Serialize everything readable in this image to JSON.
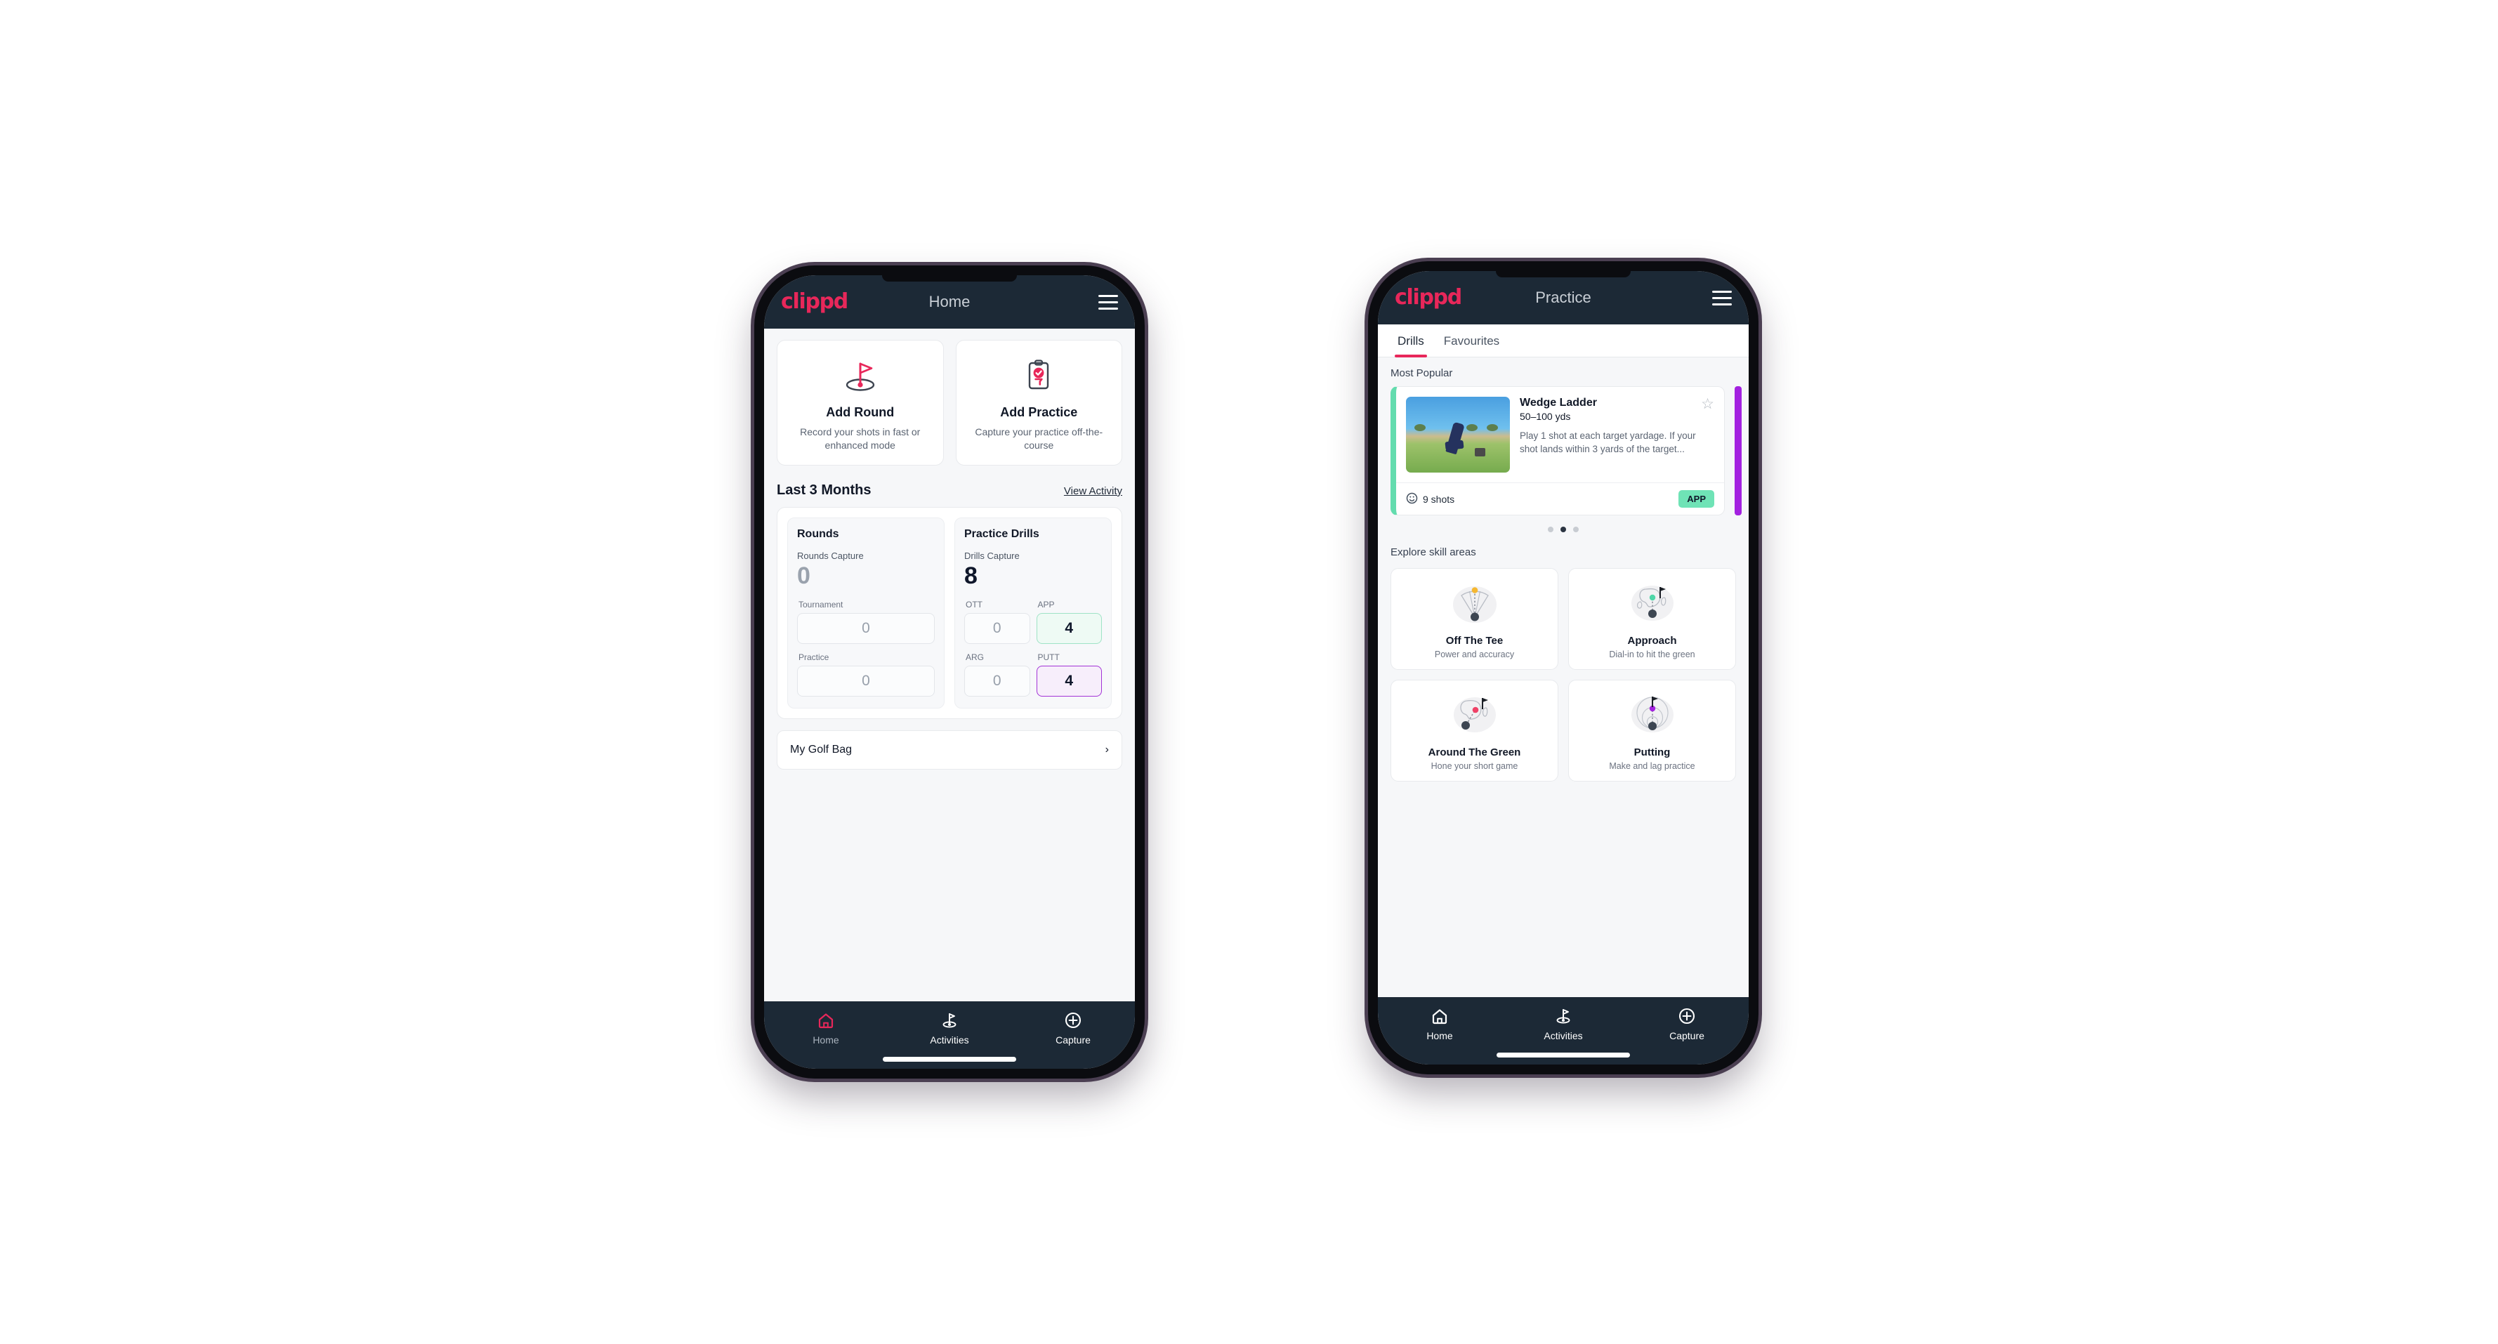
{
  "brand": {
    "logo_text": "clippd",
    "accent": "#e8275a"
  },
  "phone1": {
    "appbar": {
      "title": "Home",
      "menu_icon": "hamburger-menu-icon"
    },
    "quick_actions": [
      {
        "icon": "golf-flag-hole-icon",
        "title": "Add Round",
        "desc": "Record your shots in fast or enhanced mode"
      },
      {
        "icon": "clipboard-check-tee-icon",
        "title": "Add Practice",
        "desc": "Capture your practice off-the-course"
      }
    ],
    "section": {
      "title": "Last 3 Months",
      "link": "View Activity"
    },
    "rounds": {
      "heading": "Rounds",
      "capture_label": "Rounds Capture",
      "capture_value": "0",
      "fields": [
        {
          "label": "Tournament",
          "value": "0"
        },
        {
          "label": "Practice",
          "value": "0"
        }
      ]
    },
    "drills": {
      "heading": "Practice Drills",
      "capture_label": "Drills Capture",
      "capture_value": "8",
      "fields": [
        {
          "label": "OTT",
          "value": "0",
          "highlight": "none"
        },
        {
          "label": "APP",
          "value": "4",
          "highlight": "green"
        },
        {
          "label": "ARG",
          "value": "0",
          "highlight": "none"
        },
        {
          "label": "PUTT",
          "value": "4",
          "highlight": "purple"
        }
      ]
    },
    "golf_bag": {
      "label": "My Golf Bag",
      "chevron": "chevron-right-icon"
    },
    "bottom_nav": [
      {
        "icon": "home-icon",
        "label": "Home",
        "active": true
      },
      {
        "icon": "golf-flag-icon",
        "label": "Activities",
        "active": false
      },
      {
        "icon": "plus-circle-icon",
        "label": "Capture",
        "active": false
      }
    ]
  },
  "phone2": {
    "appbar": {
      "title": "Practice",
      "menu_icon": "hamburger-menu-icon"
    },
    "tabs": [
      {
        "label": "Drills",
        "active": true
      },
      {
        "label": "Favourites",
        "active": false
      }
    ],
    "most_popular_label": "Most Popular",
    "drill_card": {
      "title": "Wedge Ladder",
      "subtitle": "50–100 yds",
      "description": "Play 1 shot at each target yardage. If your shot lands within 3 yards of the target...",
      "shots": "9 shots",
      "shots_icon": "target-clock-icon",
      "chip": "APP",
      "chip_color": "#6fe3b6",
      "accent_left": "#63dcae",
      "accent_peek": "#a321e0",
      "favourite_icon": "star-outline-icon"
    },
    "carousel_dots": {
      "count": 3,
      "active_index": 1
    },
    "skill_section_label": "Explore skill areas",
    "skills": [
      {
        "icon": "tee-shot-fan-icon",
        "title": "Off The Tee",
        "desc": "Power and accuracy"
      },
      {
        "icon": "green-approach-icon",
        "title": "Approach",
        "desc": "Dial-in to hit the green"
      },
      {
        "icon": "chip-around-green-icon",
        "title": "Around The Green",
        "desc": "Hone your short game"
      },
      {
        "icon": "putting-rings-icon",
        "title": "Putting",
        "desc": "Make and lag practice"
      }
    ],
    "bottom_nav": [
      {
        "icon": "home-icon",
        "label": "Home",
        "active": false
      },
      {
        "icon": "golf-flag-icon",
        "label": "Activities",
        "active": false
      },
      {
        "icon": "plus-circle-icon",
        "label": "Capture",
        "active": false
      }
    ]
  }
}
